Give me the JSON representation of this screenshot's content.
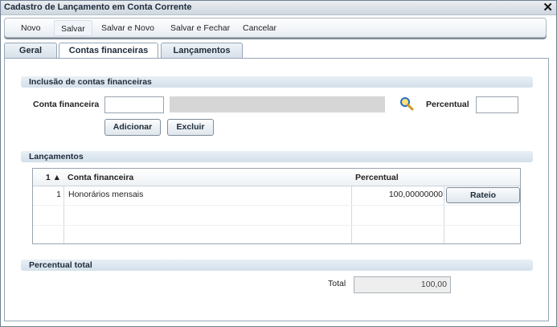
{
  "window": {
    "title": "Cadastro de Lançamento em Conta Corrente"
  },
  "toolbar": {
    "novo": "Novo",
    "salvar": "Salvar",
    "salvar_novo": "Salvar e Novo",
    "salvar_fechar": "Salvar e Fechar",
    "cancelar": "Cancelar"
  },
  "tabs": [
    "Geral",
    "Contas financeiras",
    "Lançamentos"
  ],
  "selected_tab": "Contas financeiras",
  "inclusao": {
    "header": "Inclusão de contas financeiras",
    "conta_label": "Conta financeira",
    "conta_value": "",
    "percentual_label": "Percentual",
    "percentual_value": "",
    "adicionar": "Adicionar",
    "excluir": "Excluir"
  },
  "lancamentos": {
    "header": "Lançamentos",
    "columns": {
      "num": "1 ▲",
      "conta": "Conta financeira",
      "percentual": "Percentual"
    },
    "rows": [
      {
        "num": "1",
        "conta": "Honorários mensais",
        "percentual": "100,00000000",
        "action": "Rateio"
      }
    ]
  },
  "total": {
    "header": "Percentual total",
    "label": "Total",
    "value": "100,00"
  },
  "colors": {
    "header_bg": "#d3dfea",
    "accent_text": "#1d2b3a"
  }
}
